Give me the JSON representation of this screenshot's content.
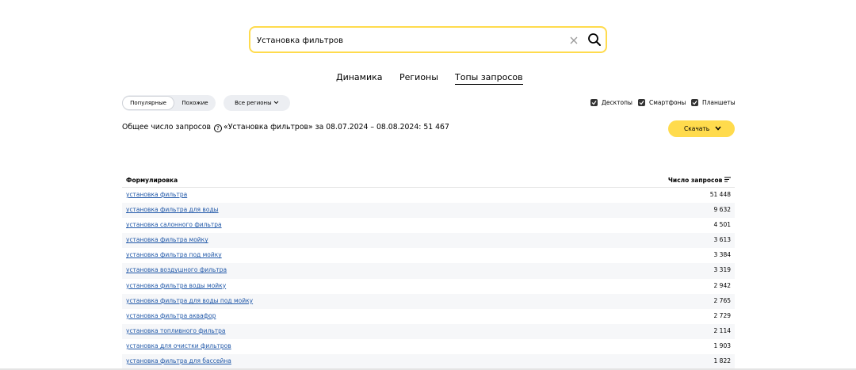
{
  "search": {
    "value": "Установка фильтров"
  },
  "tabs": [
    {
      "label": "Динамика"
    },
    {
      "label": "Регионы"
    },
    {
      "label": "Топы запросов"
    }
  ],
  "segment": {
    "popular": "Популярные",
    "similar": "Похожие"
  },
  "regions_button": "Все регионы",
  "devices": [
    {
      "label": "Десктопы",
      "checked": true
    },
    {
      "label": "Смартфоны",
      "checked": true
    },
    {
      "label": "Планшеты",
      "checked": true
    }
  ],
  "total": {
    "prefix": "Общее число запросов",
    "suffix": "«Установка фильтров» за 08.07.2024 – 08.08.2024: 51 467"
  },
  "download_button": "Скачать",
  "table": {
    "col_query": "Формулировка",
    "col_count": "Число запросов",
    "rows": [
      {
        "query": "установка фильтра",
        "count": "51 448"
      },
      {
        "query": "установка фильтра для воды",
        "count": "9 632"
      },
      {
        "query": "установка салонного фильтра",
        "count": "4 501"
      },
      {
        "query": "установка фильтра мойку",
        "count": "3 613"
      },
      {
        "query": "установка фильтра под мойку",
        "count": "3 384"
      },
      {
        "query": "установка воздушного фильтра",
        "count": "3 319"
      },
      {
        "query": "установка фильтра воды мойку",
        "count": "2 942"
      },
      {
        "query": "установка фильтра для воды под мойку",
        "count": "2 765"
      },
      {
        "query": "установка фильтра аквафор",
        "count": "2 729"
      },
      {
        "query": "установка топливного фильтра",
        "count": "2 114"
      },
      {
        "query": "установка для очистки фильтров",
        "count": "1 903"
      },
      {
        "query": "установка фильтра для бассейна",
        "count": "1 822"
      }
    ]
  },
  "colors": {
    "accent": "#ffdb4d",
    "link": "#1f57a8"
  }
}
